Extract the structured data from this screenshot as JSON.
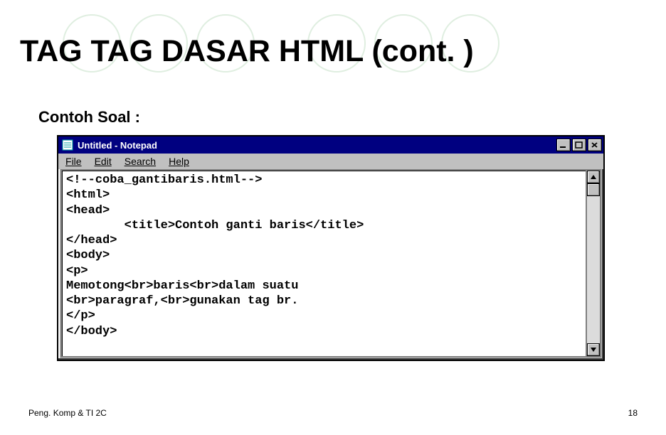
{
  "slide": {
    "title": "TAG TAG DASAR HTML (cont. )",
    "subheader": "Contoh Soal :",
    "footer_left": "Peng. Komp & TI 2C",
    "footer_right": "18"
  },
  "notepad": {
    "title": "Untitled - Notepad",
    "menu": [
      "File",
      "Edit",
      "Search",
      "Help"
    ],
    "content": "<!--coba_gantibaris.html-->\n<html>\n<head>\n        <title>Contoh ganti baris</title>\n</head>\n<body>\n<p>\nMemotong<br>baris<br>dalam suatu\n<br>paragraf,<br>gunakan tag br.\n</p>\n</body>"
  }
}
